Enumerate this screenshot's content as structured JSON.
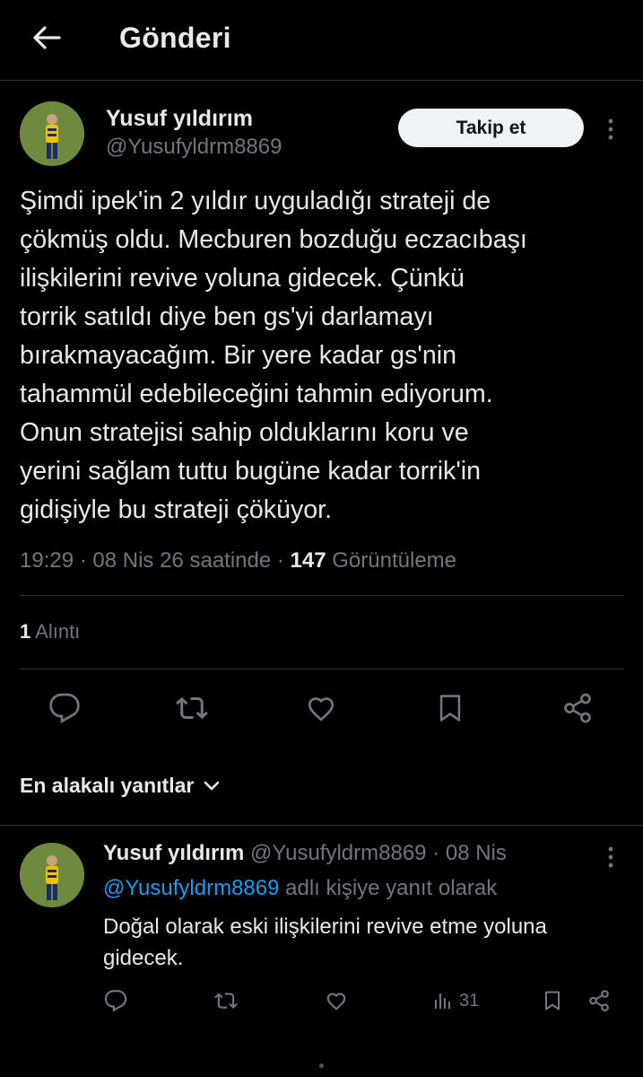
{
  "header": {
    "title": "Gönderi",
    "back_icon": "arrow-left-icon"
  },
  "tweet": {
    "author_name": "Yusuf yıldırım",
    "author_handle": "@Yusufyldrm8869",
    "follow_label": "Takip et",
    "text": "Şimdi ipek'in 2 yıldır uyguladığı strateji de\nçökmüş oldu. Mecburen bozduğu eczacıbaşı\nilişkilerini revive yoluna gidecek. Çünkü\ntorrik satıldı diye ben gs'yi darlamayı\nbırakmayacağım. Bir yere kadar gs'nin\ntahammül edebileceğini tahmin ediyorum.\nOnun stratejisi sahip olduklarını koru ve\nyerini sağlam tuttu bugüne kadar torrik'in\ngidişiyle bu strateji çöküyor.",
    "time": "19:29",
    "date": "08 Nis 26 saatinde",
    "views_count": "147",
    "views_label": "Görüntüleme",
    "quotes_count": "1",
    "quotes_label": "Alıntı",
    "actions": [
      "reply-icon",
      "retweet-icon",
      "like-icon",
      "bookmark-icon",
      "share-icon"
    ]
  },
  "replies_sort": {
    "label": "En alakalı yanıtlar",
    "icon": "chevron-down-icon"
  },
  "reply": {
    "author_name": "Yusuf yıldırım",
    "author_handle": "@Yusufyldrm8869",
    "date": "08 Nis",
    "replying_to_handle": "@Yusufyldrm8869",
    "replying_to_suffix": "adlı kişiye yanıt olarak",
    "text": "Doğal olarak eski ilişkilerini revive etme  yoluna\ngidecek.",
    "views_count": "31"
  },
  "colors": {
    "background": "#000000",
    "text_primary": "#e7e9ea",
    "text_secondary": "#71767b",
    "link": "#1d9bf0",
    "divider": "#2f3336",
    "button_bg": "#eff3f4"
  }
}
